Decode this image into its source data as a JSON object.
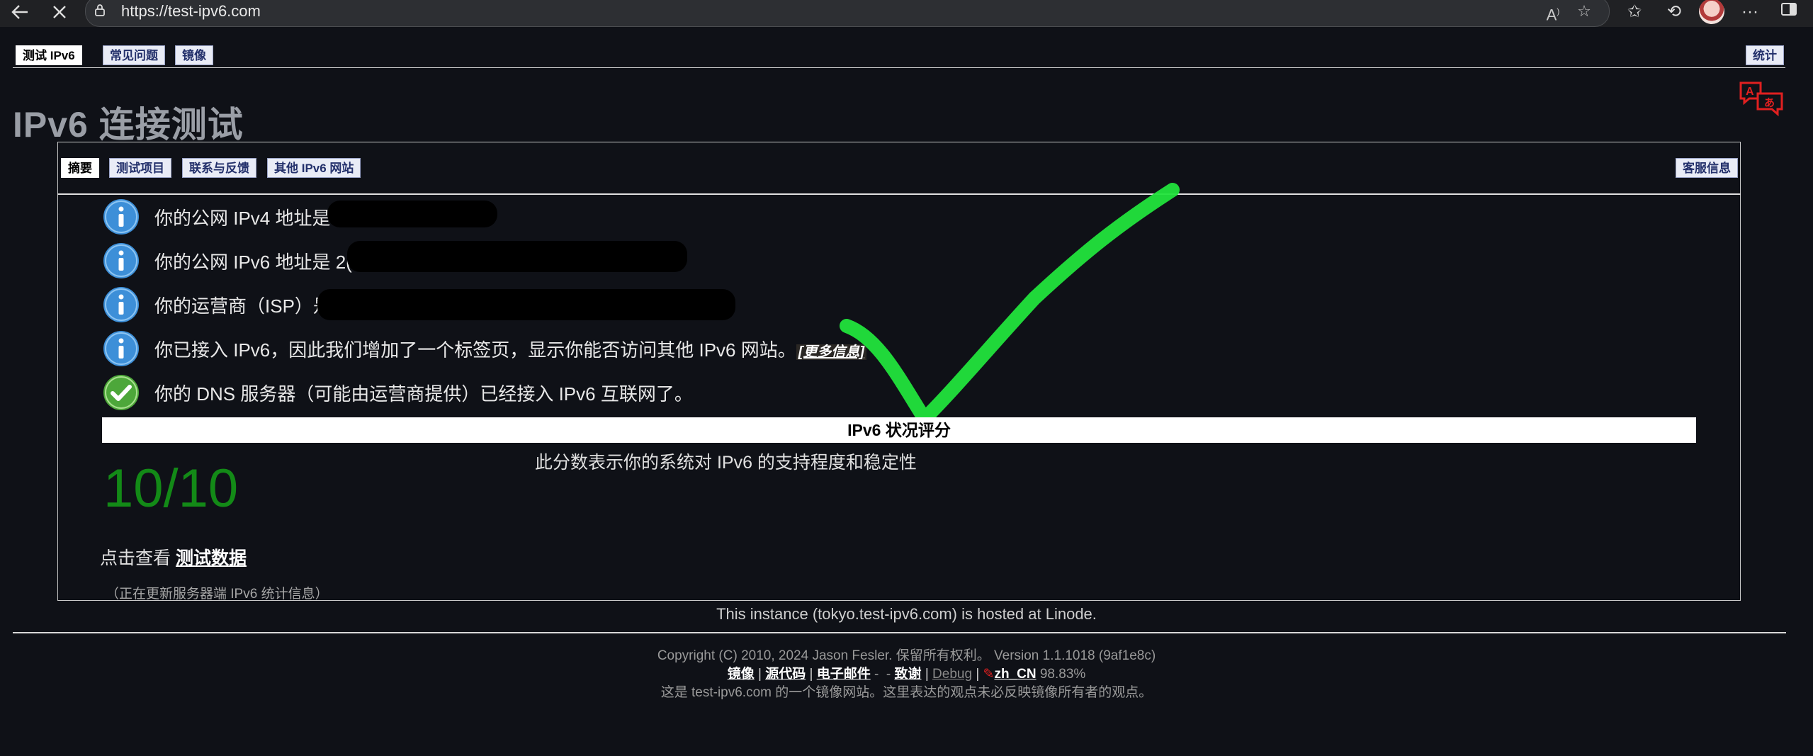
{
  "browser": {
    "url": "https://test-ipv6.com",
    "icons": [
      "back-icon",
      "stop-icon",
      "lock-icon",
      "read-aloud-icon",
      "favorite-star-icon",
      "favorites-icon",
      "history-icon",
      "avatar",
      "more-icon",
      "sidebar-icon"
    ]
  },
  "top_tabs": {
    "items": [
      "测试 IPv6",
      "常见问题",
      "镜像"
    ],
    "active": "测试 IPv6",
    "right_tab": "统计"
  },
  "page_title": "IPv6 连接测试",
  "panel_tabs": {
    "items": [
      "摘要",
      "测试项目",
      "联系与反馈",
      "其他 IPv6 网站"
    ],
    "active": "摘要",
    "right_tab": "客服信息"
  },
  "summary": {
    "rows": [
      {
        "icon": "info-icon",
        "text": "你的公网 IPv4 地址是"
      },
      {
        "icon": "info-icon",
        "text": "你的公网 IPv6 地址是 2("
      },
      {
        "icon": "info-icon",
        "text": "你的运营商（ISP）是"
      },
      {
        "icon": "info-icon",
        "text": "你已接入 IPv6，因此我们增加了一个标签页，显示你能否访问其他 IPv6 网站。",
        "link": "[更多信息]"
      },
      {
        "icon": "check-icon",
        "text": "你的 DNS 服务器（可能由运营商提供）已经接入 IPv6 互联网了。"
      }
    ]
  },
  "score": {
    "header": "IPv6 状况评分",
    "description": "此分数表示你的系统对 IPv6 的支持程度和稳定性",
    "value": "10/10",
    "view_prefix": "点击查看",
    "view_link": "测试数据",
    "status": "（正在更新服务器端 IPv6 统计信息）"
  },
  "hosted_text": "This instance (tokyo.test-ipv6.com) is hosted at Linode.",
  "footer": {
    "copyright": "Copyright (C) 2010, 2024 Jason Fesler. 保留所有权利。 Version 1.1.1018 (9af1e8c)",
    "links": {
      "mirror": "镜像",
      "source": "源代码",
      "email": "电子邮件",
      "thanks": "致谢",
      "debug": "Debug",
      "locale": "zh_CN",
      "percent": "98.83%"
    },
    "mirror_note": "这是 test-ipv6.com 的一个镜像网站。这里表达的观点未必反映镜像所有者的观点。"
  },
  "colors": {
    "background": "#0f1117",
    "score_green": "#138a17",
    "check_overlay": "#22e43c",
    "info_blue": "#3d8fd8"
  }
}
